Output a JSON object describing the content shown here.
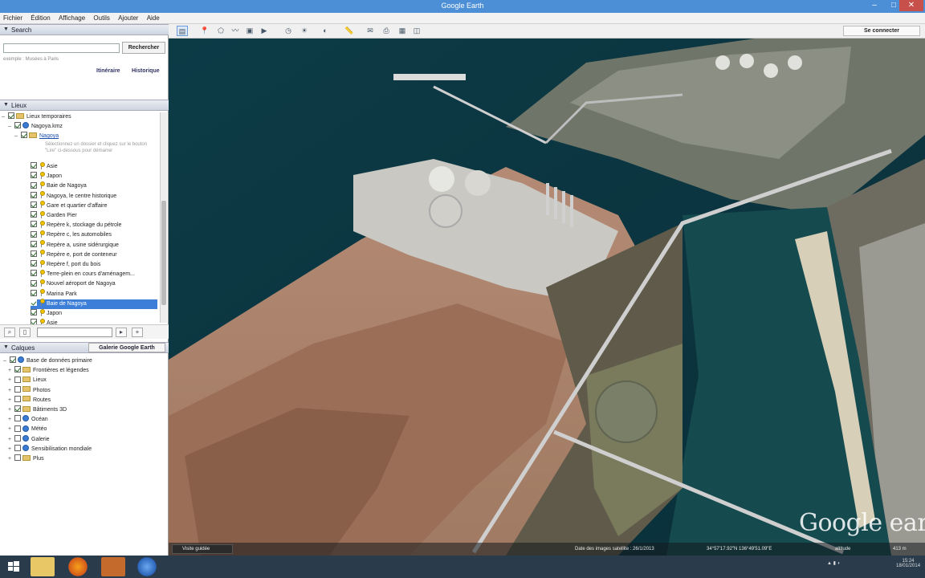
{
  "window": {
    "title": "Google Earth"
  },
  "menu": [
    "Fichier",
    "Édition",
    "Affichage",
    "Outils",
    "Ajouter",
    "Aide"
  ],
  "search": {
    "header": "Search",
    "placeholder": "",
    "button": "Rechercher",
    "hint": "exemple : Musées à Paris",
    "directions_link": "Itinéraire",
    "history_link": "Historique"
  },
  "places": {
    "header": "Lieux",
    "temp": "Lieux temporaires",
    "file": "Nagoya.kmz",
    "folder": "Nagoya",
    "note": "Sélectionnez un dossier et cliquez sur le bouton \"Lire\" ci-dessous pour démarrer",
    "items": [
      "Asie",
      "Japon",
      "Baie de Nagoya",
      "Nagoya, le centre historique",
      "Gare et quartier d'affaire",
      "Garden Pier",
      "Repère k, stockage du pétrole",
      "Repère c, les automobiles",
      "Repère a, usine sidérurgique",
      "Repère e, port de conteneur",
      "Repère f, port du bois",
      "Terre-plein en cours d'aménagem...",
      "Nouvel aéroport de Nagoya",
      "Marina Park",
      "Baie de Nagoya",
      "Japon",
      "Asie"
    ],
    "selected_index": 14
  },
  "layers": {
    "header": "Calques",
    "gallery_button": "Galerie Google Earth",
    "items": [
      "Base de données primaire",
      "Frontières et légendes",
      "Lieux",
      "Photos",
      "Routes",
      "Bâtiments 3D",
      "Océan",
      "Météo",
      "Galerie",
      "Sensibilisation mondiale",
      "Plus"
    ]
  },
  "toolbar": {
    "signin": "Se connecter"
  },
  "map": {
    "watermark": "Google earth",
    "history_button": "Visite guidée",
    "imagery_date": "Date des images satellite : 26/1/2013",
    "coords": "34°57'17.92\"N  136°49'51.09\"E",
    "altitude": "altitude",
    "elevation": "413 m"
  },
  "taskbar": {
    "time": "15:24",
    "date": "18/01/2014"
  }
}
